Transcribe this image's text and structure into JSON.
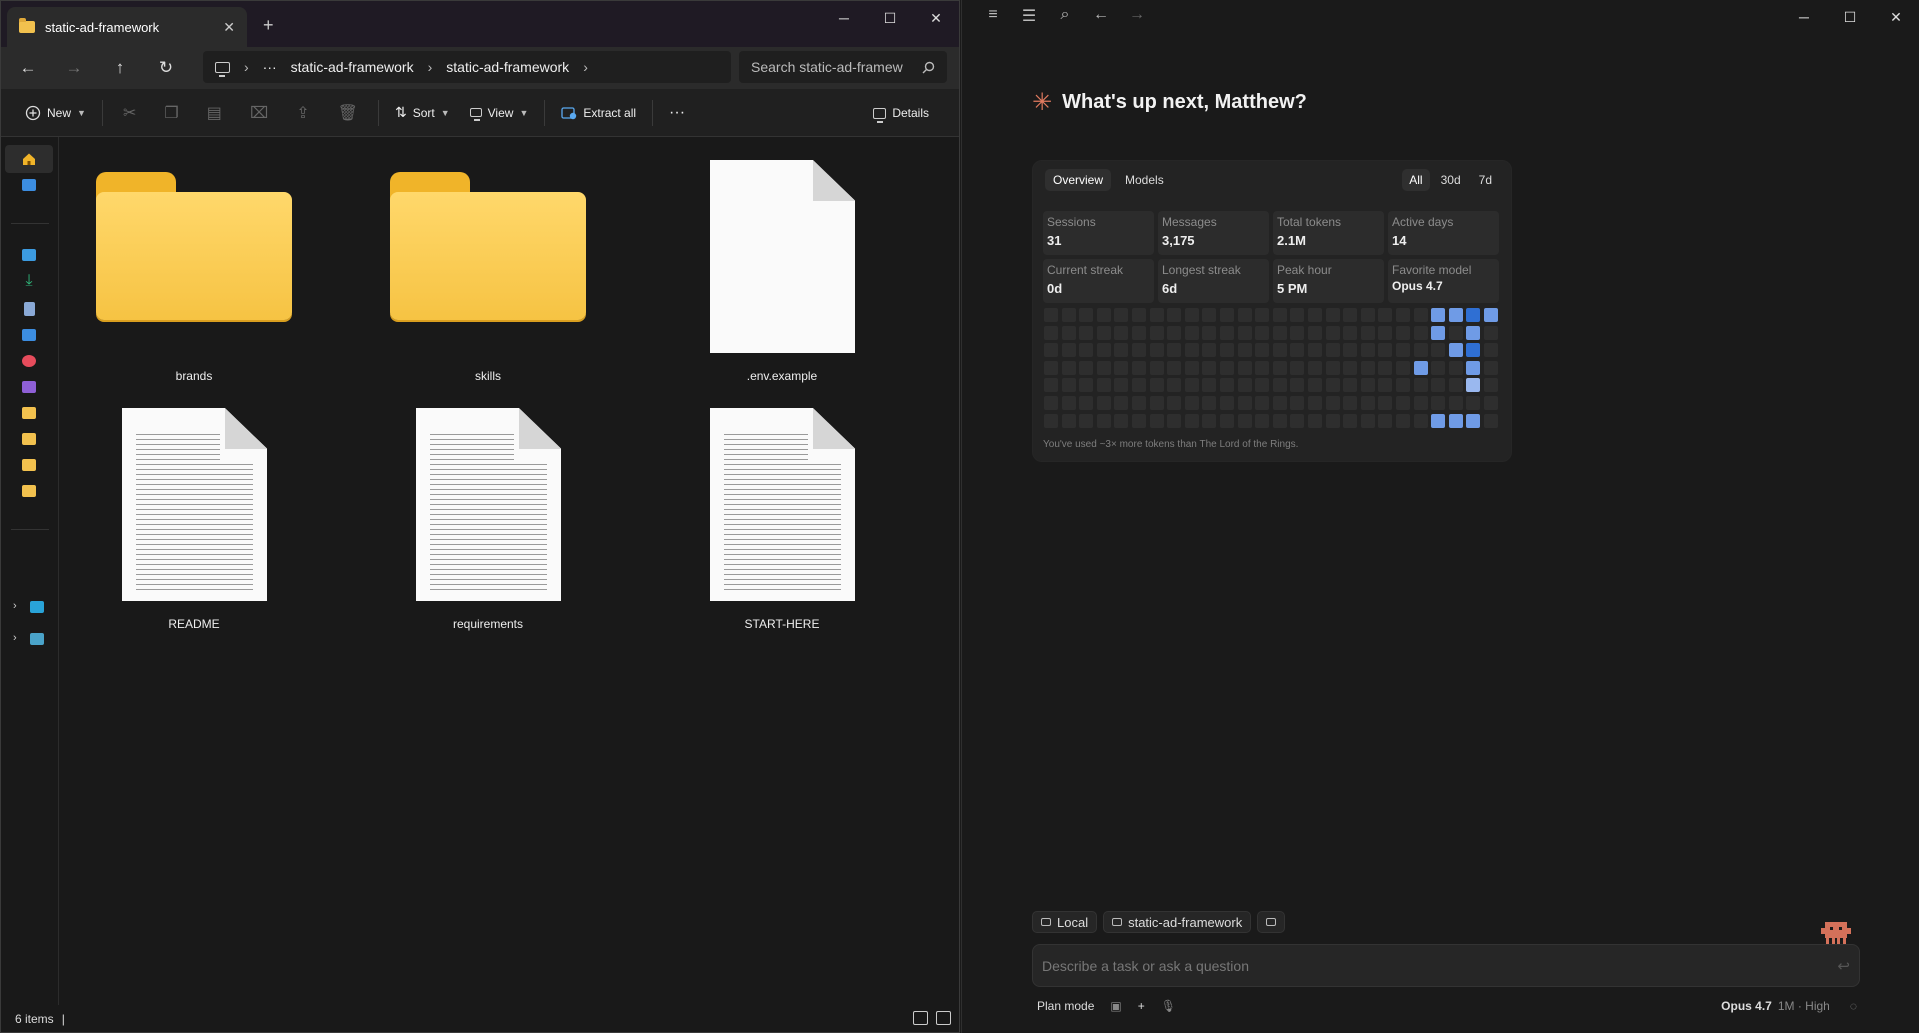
{
  "explorer": {
    "tab_title": "static-ad-framework",
    "tab_close": "✕",
    "new_tab": "+",
    "window_controls": {
      "minimize": "─",
      "maximize": "☐",
      "close": "✕"
    },
    "nav": {
      "back": "←",
      "forward": "→",
      "up": "↑",
      "refresh": "↻"
    },
    "breadcrumb": {
      "more": "···",
      "items": [
        "static-ad-framework",
        "static-ad-framework"
      ],
      "sep": "›"
    },
    "search_placeholder": "Search static-ad-framew",
    "toolbar": {
      "new_label": "New",
      "sort_label": "Sort",
      "view_label": "View",
      "extract_label": "Extract all",
      "more_label": "···",
      "details_label": "Details"
    },
    "files": [
      {
        "name": "brands",
        "type": "folder"
      },
      {
        "name": "skills",
        "type": "folder"
      },
      {
        "name": ".env.example",
        "type": "blank"
      },
      {
        "name": "README",
        "type": "text"
      },
      {
        "name": "requirements",
        "type": "text"
      },
      {
        "name": "START-HERE",
        "type": "text"
      }
    ],
    "status": "6 items",
    "colors": {
      "folder": "#f6c343",
      "accent_nav": [
        "#3c8de0",
        "#2fb67a",
        "#9b59b6",
        "#e74c3c"
      ]
    }
  },
  "claude": {
    "greeting": "What's up next, Matthew?",
    "spark": "✳",
    "window_controls": {
      "minimize": "─",
      "maximize": "☐",
      "close": "✕"
    },
    "stats": {
      "tabs": [
        "Overview",
        "Models"
      ],
      "ranges": [
        "All",
        "30d",
        "7d"
      ],
      "metrics": [
        {
          "label": "Sessions",
          "value": "31"
        },
        {
          "label": "Messages",
          "value": "3,175"
        },
        {
          "label": "Total tokens",
          "value": "2.1M"
        },
        {
          "label": "Active days",
          "value": "14"
        },
        {
          "label": "Current streak",
          "value": "0d"
        },
        {
          "label": "Longest streak",
          "value": "6d"
        },
        {
          "label": "Peak hour",
          "value": "5 PM"
        },
        {
          "label": "Favorite model",
          "value": "Opus 4.7"
        }
      ],
      "heatmap": {
        "columns": 26,
        "rows": 7,
        "active": [
          {
            "col": 22,
            "row": 0,
            "level": 2
          },
          {
            "col": 23,
            "row": 0,
            "level": 2
          },
          {
            "col": 24,
            "row": 0,
            "level": 3
          },
          {
            "col": 25,
            "row": 0,
            "level": 2
          },
          {
            "col": 22,
            "row": 1,
            "level": 2
          },
          {
            "col": 24,
            "row": 1,
            "level": 2
          },
          {
            "col": 23,
            "row": 2,
            "level": 2
          },
          {
            "col": 24,
            "row": 2,
            "level": 3
          },
          {
            "col": 21,
            "row": 3,
            "level": 2
          },
          {
            "col": 24,
            "row": 3,
            "level": 2
          },
          {
            "col": 24,
            "row": 4,
            "level": 1
          },
          {
            "col": 22,
            "row": 6,
            "level": 2
          },
          {
            "col": 23,
            "row": 6,
            "level": 2
          },
          {
            "col": 24,
            "row": 6,
            "level": 2
          }
        ],
        "colors": {
          "empty": "#2e2e2e",
          "level1": "#9ab8ef",
          "level2": "#6f9be6",
          "level3": "#2f6fd3"
        }
      },
      "footer": "You've used ~3× more tokens than The Lord of the Rings."
    },
    "chips": {
      "local": "Local",
      "project": "static-ad-framework"
    },
    "prompt_placeholder": "Describe a task or ask a question",
    "bottom": {
      "plan_mode": "Plan mode",
      "model": "Opus 4.7",
      "context": "1M · High"
    }
  }
}
